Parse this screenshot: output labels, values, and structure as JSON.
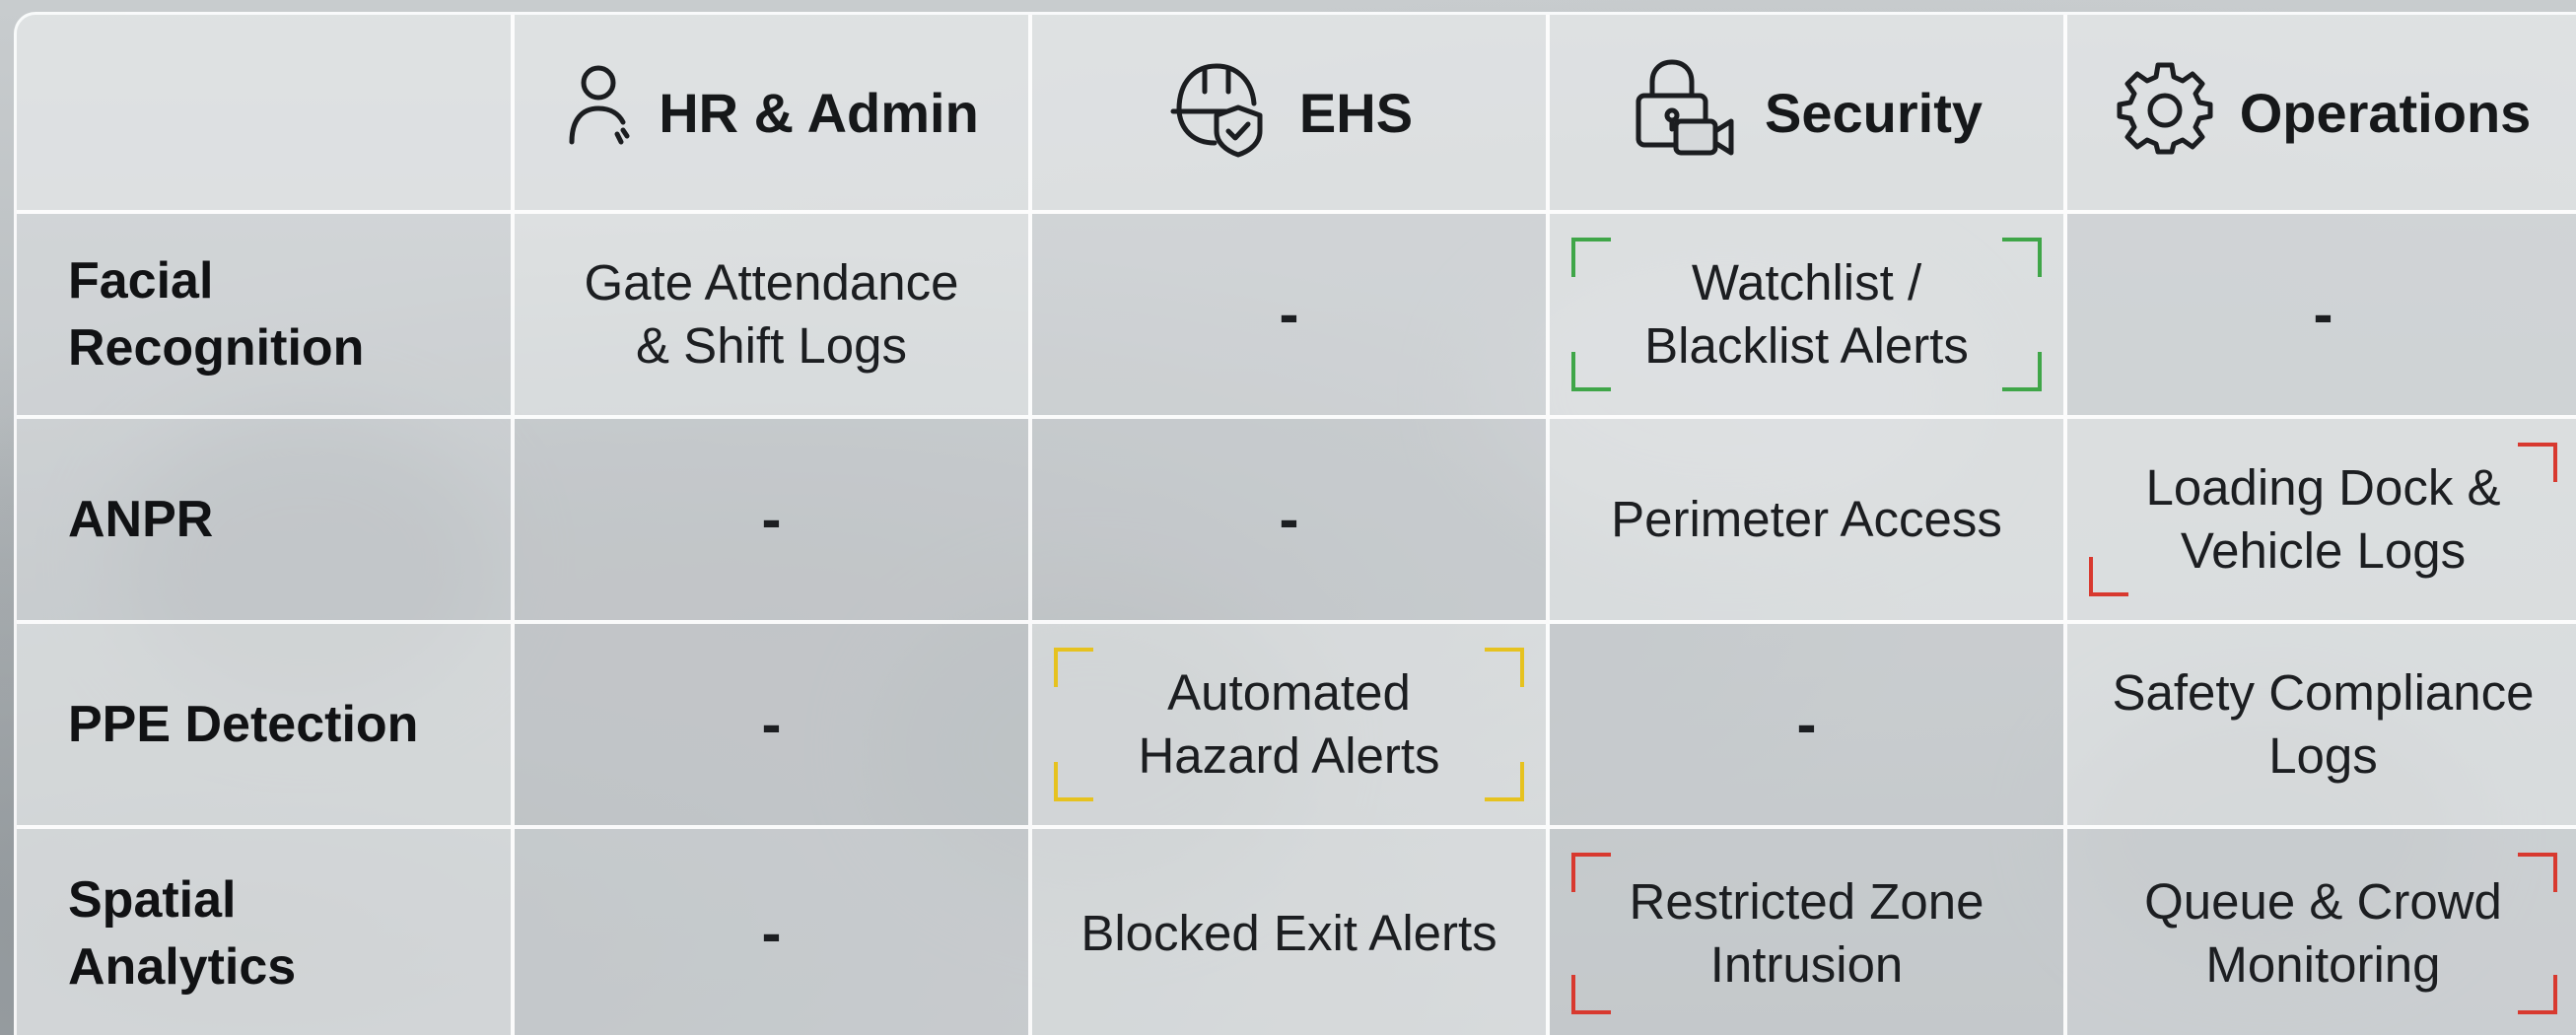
{
  "columns": [
    {
      "label": "HR & Admin",
      "icon": "person-icon"
    },
    {
      "label": "EHS",
      "icon": "helmet-shield-icon"
    },
    {
      "label": "Security",
      "icon": "lock-camera-icon"
    },
    {
      "label": "Operations",
      "icon": "gear-icon"
    }
  ],
  "rows": [
    {
      "label": "Facial Recognition",
      "label_lines": [
        "Facial",
        "Recognition"
      ],
      "cells": [
        {
          "lines": [
            "Gate Attendance",
            "& Shift Logs"
          ]
        },
        {
          "lines": [
            "-"
          ]
        },
        {
          "lines": [
            "Watchlist /",
            "Blacklist Alerts"
          ],
          "bracket": "#3fa648"
        },
        {
          "lines": [
            "-"
          ]
        }
      ]
    },
    {
      "label": "ANPR",
      "label_lines": [
        "ANPR"
      ],
      "cells": [
        {
          "lines": [
            "-"
          ]
        },
        {
          "lines": [
            "-"
          ]
        },
        {
          "lines": [
            "Perimeter Access"
          ]
        },
        {
          "lines": [
            "Loading Dock &",
            "Vehicle Logs"
          ],
          "bracket": "#d8392f",
          "bracket_corners": [
            "tr",
            "bl"
          ]
        }
      ]
    },
    {
      "label": "PPE Detection",
      "label_lines": [
        "PPE Detection"
      ],
      "cells": [
        {
          "lines": [
            "-"
          ]
        },
        {
          "lines": [
            "Automated",
            "Hazard Alerts"
          ],
          "bracket": "#e6c21f"
        },
        {
          "lines": [
            "-"
          ]
        },
        {
          "lines": [
            "Safety Compliance",
            "Logs"
          ]
        }
      ]
    },
    {
      "label": "Spatial Analytics",
      "label_lines": [
        "Spatial",
        "Analytics"
      ],
      "cells": [
        {
          "lines": [
            "-"
          ]
        },
        {
          "lines": [
            "Blocked Exit Alerts"
          ]
        },
        {
          "lines": [
            "Restricted Zone",
            "Intrusion"
          ],
          "bracket": "#d8392f",
          "bracket_corners": [
            "tl",
            "bl"
          ]
        },
        {
          "lines": [
            "Queue & Crowd",
            "Monitoring"
          ],
          "bracket": "#d8392f",
          "bracket_corners": [
            "tr",
            "br"
          ]
        }
      ]
    }
  ]
}
